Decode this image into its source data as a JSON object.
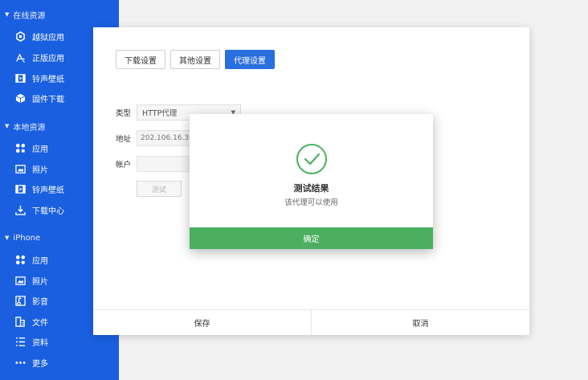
{
  "sidebar": {
    "sections": [
      {
        "label": "在线资源",
        "items": [
          {
            "label": "越狱应用",
            "icon": "jailbreak-app-icon"
          },
          {
            "label": "正版应用",
            "icon": "app-store-icon"
          },
          {
            "label": "铃声壁纸",
            "icon": "ringtone-wallpaper-icon"
          },
          {
            "label": "固件下载",
            "icon": "firmware-icon"
          }
        ]
      },
      {
        "label": "本地资源",
        "items": [
          {
            "label": "应用",
            "icon": "apps-icon"
          },
          {
            "label": "照片",
            "icon": "photo-icon"
          },
          {
            "label": "铃声壁纸",
            "icon": "ringtone-wallpaper-icon"
          },
          {
            "label": "下载中心",
            "icon": "download-icon"
          }
        ]
      },
      {
        "label": "iPhone",
        "items": [
          {
            "label": "应用",
            "icon": "apps-icon"
          },
          {
            "label": "照片",
            "icon": "photo-icon"
          },
          {
            "label": "影音",
            "icon": "media-icon"
          },
          {
            "label": "文件",
            "icon": "file-icon"
          },
          {
            "label": "资料",
            "icon": "list-icon"
          },
          {
            "label": "更多",
            "icon": "more-icon"
          }
        ]
      }
    ]
  },
  "settings": {
    "tabs": [
      {
        "label": "下载设置",
        "active": false
      },
      {
        "label": "其他设置",
        "active": false
      },
      {
        "label": "代理设置",
        "active": true
      }
    ],
    "type_label": "类型",
    "type_value": "HTTP代理",
    "address_label": "地址",
    "address_placeholder": "202.106.16.36",
    "account_label": "帐户",
    "test_label": "测试",
    "save_label": "保存",
    "cancel_label": "取消"
  },
  "result": {
    "title": "测试结果",
    "message": "该代理可以使用",
    "confirm_label": "确定"
  },
  "colors": {
    "sidebar": "#1a5fe0",
    "active_tab": "#2a6fe0",
    "confirm": "#4caf60",
    "check": "#4caf60"
  }
}
